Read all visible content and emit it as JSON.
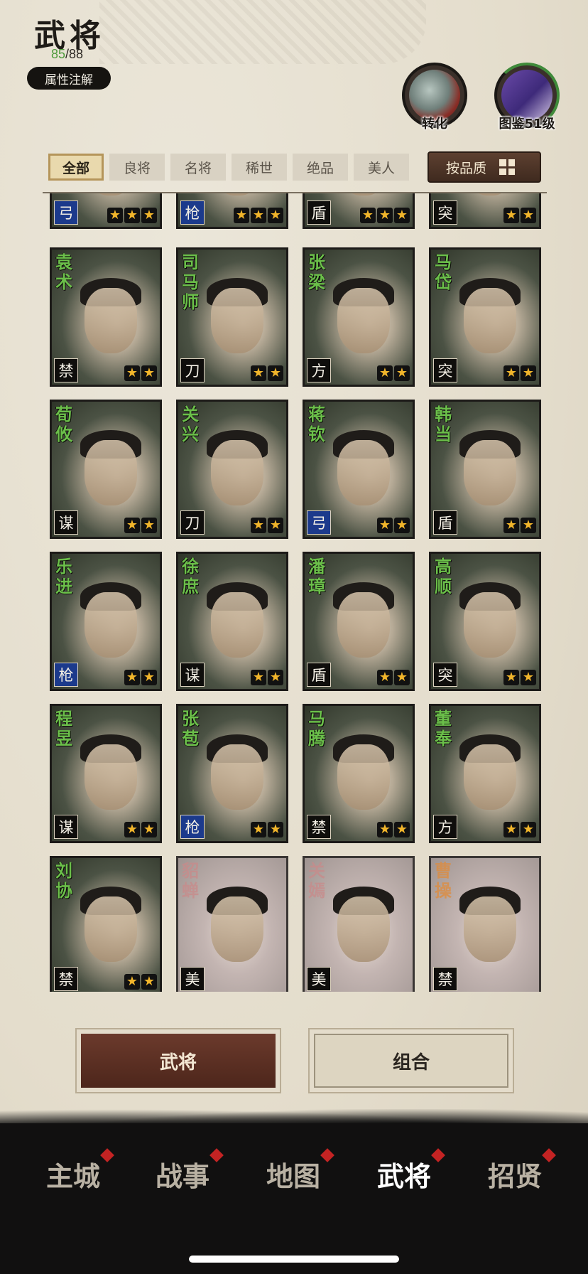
{
  "header": {
    "title": "武将",
    "owned_count": "85",
    "total_count": "/88",
    "attr_button": "属性注解"
  },
  "corner_buttons": {
    "convert_label": "转化",
    "atlas_label": "图鉴51级"
  },
  "filters": {
    "tabs": [
      "全部",
      "良将",
      "名将",
      "稀世",
      "绝品",
      "美人"
    ],
    "active_index": 0,
    "sort_label": "按品质"
  },
  "partial_row": [
    {
      "type": "弓",
      "type_color": "blue",
      "stars": 3
    },
    {
      "type": "枪",
      "type_color": "blue",
      "stars": 3
    },
    {
      "type": "盾",
      "type_color": "black",
      "stars": 3
    },
    {
      "type": "突",
      "type_color": "black",
      "stars": 2
    }
  ],
  "heroes": [
    {
      "name": "袁术",
      "type": "禁",
      "type_color": "black",
      "stars": 2
    },
    {
      "name": "司马师",
      "type": "刀",
      "type_color": "black",
      "stars": 2
    },
    {
      "name": "张梁",
      "type": "方",
      "type_color": "black",
      "stars": 2
    },
    {
      "name": "马岱",
      "type": "突",
      "type_color": "black",
      "stars": 2
    },
    {
      "name": "荀攸",
      "type": "谋",
      "type_color": "black",
      "stars": 2
    },
    {
      "name": "关兴",
      "type": "刀",
      "type_color": "black",
      "stars": 2
    },
    {
      "name": "蒋钦",
      "type": "弓",
      "type_color": "blue",
      "stars": 2
    },
    {
      "name": "韩当",
      "type": "盾",
      "type_color": "black",
      "stars": 2
    },
    {
      "name": "乐进",
      "type": "枪",
      "type_color": "blue",
      "stars": 2
    },
    {
      "name": "徐庶",
      "type": "谋",
      "type_color": "black",
      "stars": 2
    },
    {
      "name": "潘璋",
      "type": "盾",
      "type_color": "black",
      "stars": 2
    },
    {
      "name": "高顺",
      "type": "突",
      "type_color": "black",
      "stars": 2
    },
    {
      "name": "程昱",
      "type": "谋",
      "type_color": "black",
      "stars": 2
    },
    {
      "name": "张苞",
      "type": "枪",
      "type_color": "blue",
      "stars": 2
    },
    {
      "name": "马腾",
      "type": "禁",
      "type_color": "black",
      "stars": 2
    },
    {
      "name": "董奉",
      "type": "方",
      "type_color": "black",
      "stars": 2
    },
    {
      "name": "刘协",
      "type": "禁",
      "type_color": "black",
      "stars": 2
    },
    {
      "name": "貂蝉",
      "type": "美",
      "type_color": "black",
      "stars": 0,
      "locked": true
    },
    {
      "name": "关嫣",
      "type": "美",
      "type_color": "black",
      "stars": 0,
      "locked": true
    },
    {
      "name": "曹操",
      "type": "禁",
      "type_color": "black",
      "stars": 0,
      "locked": true,
      "name_color": "orange"
    }
  ],
  "actions": {
    "hero_button": "武将",
    "combo_button": "组合"
  },
  "nav": {
    "items": [
      "主城",
      "战事",
      "地图",
      "武将",
      "招贤"
    ],
    "active_index": 3
  },
  "colors": {
    "name_green": "#6bbf4a",
    "star_gold": "#f1b52b",
    "type_blue": "#1c3a8c",
    "nav_dot_red": "#c42323"
  }
}
